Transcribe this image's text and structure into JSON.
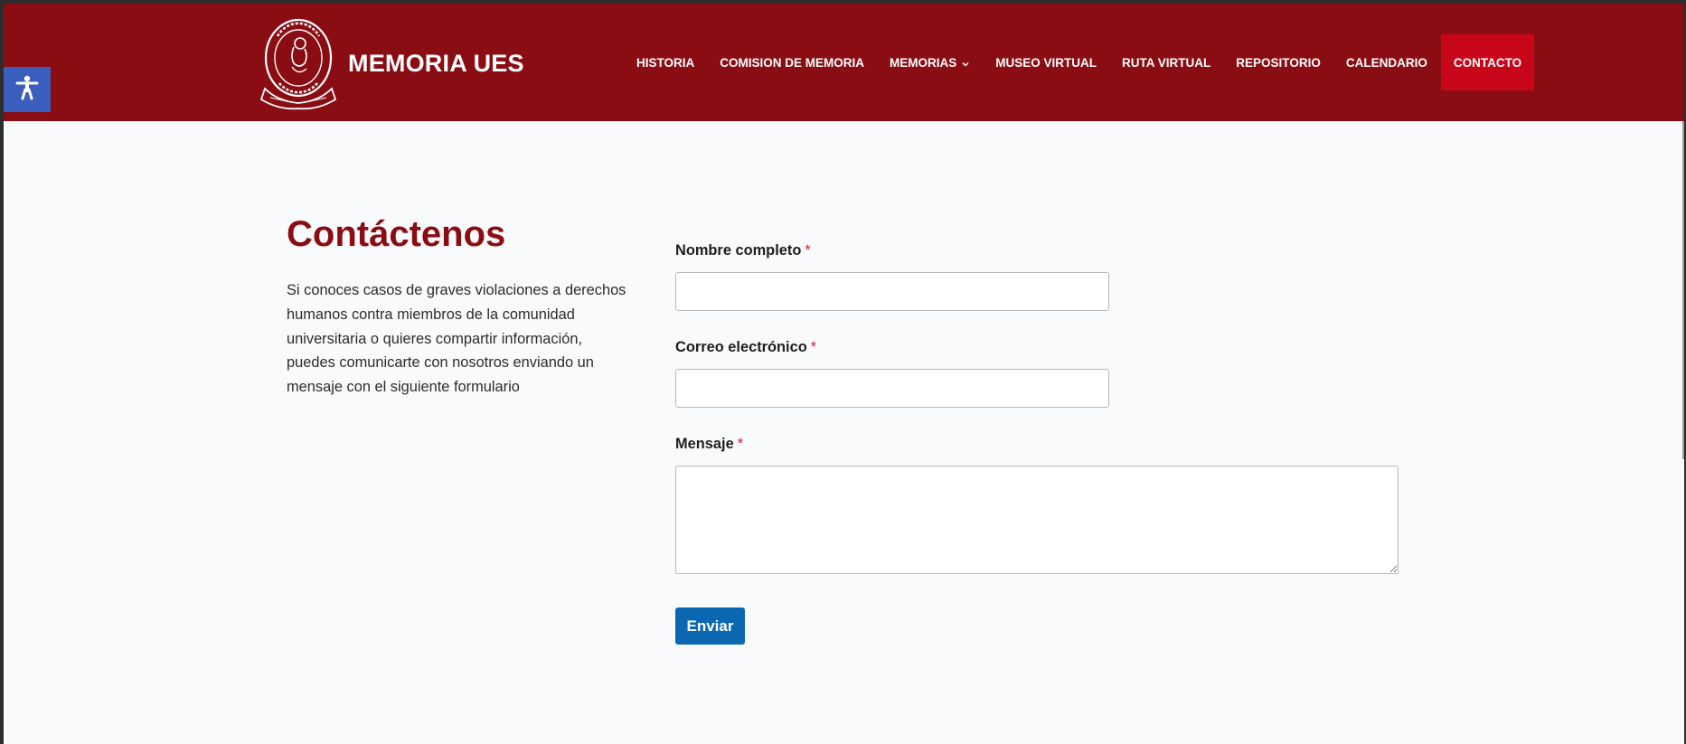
{
  "header": {
    "site_title": "MEMORIA UES",
    "logo_icon": "university-seal-icon",
    "background_color": "#8b0d14",
    "nav": [
      {
        "label": "HISTORIA"
      },
      {
        "label": "COMISION DE MEMORIA"
      },
      {
        "label": "MEMORIAS",
        "has_dropdown": true
      },
      {
        "label": "MUSEO VIRTUAL"
      },
      {
        "label": "RUTA VIRTUAL"
      },
      {
        "label": "REPOSITORIO"
      },
      {
        "label": "CALENDARIO"
      },
      {
        "label": "CONTACTO",
        "active": true
      }
    ],
    "active_nav_color": "#c8061a"
  },
  "accessibility": {
    "icon": "accessibility-person-icon",
    "color": "#3b5fbf"
  },
  "contact": {
    "heading": "Contáctenos",
    "intro": "Si conoces casos de graves violaciones a derechos humanos contra miembros de la comunidad universitaria o quieres compartir información, puedes comunicarte con nosotros enviando un mensaje con el siguiente formulario",
    "required_marker": "*",
    "fields": {
      "name": {
        "label": "Nombre completo",
        "value": "",
        "placeholder": ""
      },
      "email": {
        "label": "Correo electrónico",
        "value": "",
        "placeholder": ""
      },
      "message": {
        "label": "Mensaje",
        "value": "",
        "placeholder": ""
      }
    },
    "submit_label": "Enviar",
    "submit_color": "#0b67b2"
  }
}
